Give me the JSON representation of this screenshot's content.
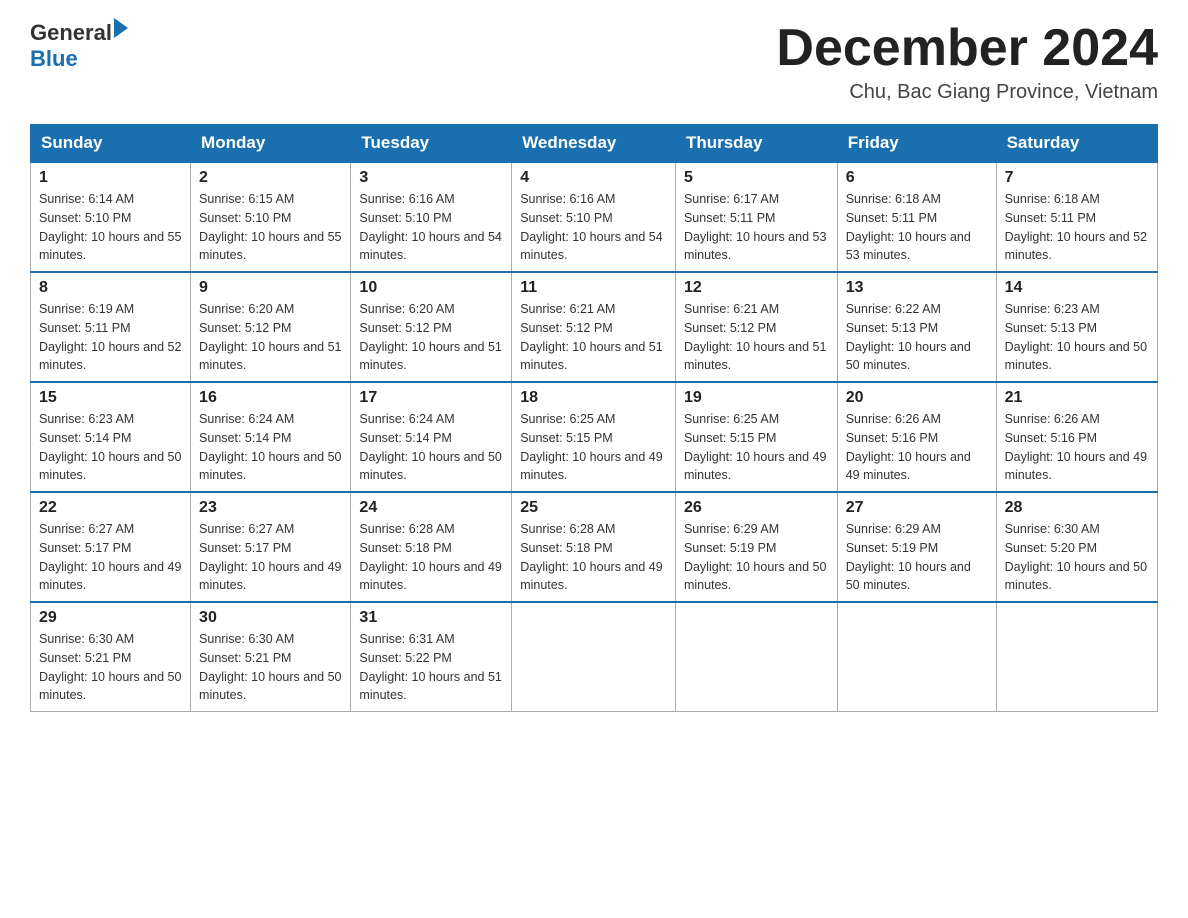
{
  "header": {
    "logo_general": "General",
    "logo_blue": "Blue",
    "title": "December 2024",
    "subtitle": "Chu, Bac Giang Province, Vietnam"
  },
  "weekdays": [
    "Sunday",
    "Monday",
    "Tuesday",
    "Wednesday",
    "Thursday",
    "Friday",
    "Saturday"
  ],
  "weeks": [
    [
      {
        "day": "1",
        "sunrise": "6:14 AM",
        "sunset": "5:10 PM",
        "daylight": "10 hours and 55 minutes."
      },
      {
        "day": "2",
        "sunrise": "6:15 AM",
        "sunset": "5:10 PM",
        "daylight": "10 hours and 55 minutes."
      },
      {
        "day": "3",
        "sunrise": "6:16 AM",
        "sunset": "5:10 PM",
        "daylight": "10 hours and 54 minutes."
      },
      {
        "day": "4",
        "sunrise": "6:16 AM",
        "sunset": "5:10 PM",
        "daylight": "10 hours and 54 minutes."
      },
      {
        "day": "5",
        "sunrise": "6:17 AM",
        "sunset": "5:11 PM",
        "daylight": "10 hours and 53 minutes."
      },
      {
        "day": "6",
        "sunrise": "6:18 AM",
        "sunset": "5:11 PM",
        "daylight": "10 hours and 53 minutes."
      },
      {
        "day": "7",
        "sunrise": "6:18 AM",
        "sunset": "5:11 PM",
        "daylight": "10 hours and 52 minutes."
      }
    ],
    [
      {
        "day": "8",
        "sunrise": "6:19 AM",
        "sunset": "5:11 PM",
        "daylight": "10 hours and 52 minutes."
      },
      {
        "day": "9",
        "sunrise": "6:20 AM",
        "sunset": "5:12 PM",
        "daylight": "10 hours and 51 minutes."
      },
      {
        "day": "10",
        "sunrise": "6:20 AM",
        "sunset": "5:12 PM",
        "daylight": "10 hours and 51 minutes."
      },
      {
        "day": "11",
        "sunrise": "6:21 AM",
        "sunset": "5:12 PM",
        "daylight": "10 hours and 51 minutes."
      },
      {
        "day": "12",
        "sunrise": "6:21 AM",
        "sunset": "5:12 PM",
        "daylight": "10 hours and 51 minutes."
      },
      {
        "day": "13",
        "sunrise": "6:22 AM",
        "sunset": "5:13 PM",
        "daylight": "10 hours and 50 minutes."
      },
      {
        "day": "14",
        "sunrise": "6:23 AM",
        "sunset": "5:13 PM",
        "daylight": "10 hours and 50 minutes."
      }
    ],
    [
      {
        "day": "15",
        "sunrise": "6:23 AM",
        "sunset": "5:14 PM",
        "daylight": "10 hours and 50 minutes."
      },
      {
        "day": "16",
        "sunrise": "6:24 AM",
        "sunset": "5:14 PM",
        "daylight": "10 hours and 50 minutes."
      },
      {
        "day": "17",
        "sunrise": "6:24 AM",
        "sunset": "5:14 PM",
        "daylight": "10 hours and 50 minutes."
      },
      {
        "day": "18",
        "sunrise": "6:25 AM",
        "sunset": "5:15 PM",
        "daylight": "10 hours and 49 minutes."
      },
      {
        "day": "19",
        "sunrise": "6:25 AM",
        "sunset": "5:15 PM",
        "daylight": "10 hours and 49 minutes."
      },
      {
        "day": "20",
        "sunrise": "6:26 AM",
        "sunset": "5:16 PM",
        "daylight": "10 hours and 49 minutes."
      },
      {
        "day": "21",
        "sunrise": "6:26 AM",
        "sunset": "5:16 PM",
        "daylight": "10 hours and 49 minutes."
      }
    ],
    [
      {
        "day": "22",
        "sunrise": "6:27 AM",
        "sunset": "5:17 PM",
        "daylight": "10 hours and 49 minutes."
      },
      {
        "day": "23",
        "sunrise": "6:27 AM",
        "sunset": "5:17 PM",
        "daylight": "10 hours and 49 minutes."
      },
      {
        "day": "24",
        "sunrise": "6:28 AM",
        "sunset": "5:18 PM",
        "daylight": "10 hours and 49 minutes."
      },
      {
        "day": "25",
        "sunrise": "6:28 AM",
        "sunset": "5:18 PM",
        "daylight": "10 hours and 49 minutes."
      },
      {
        "day": "26",
        "sunrise": "6:29 AM",
        "sunset": "5:19 PM",
        "daylight": "10 hours and 50 minutes."
      },
      {
        "day": "27",
        "sunrise": "6:29 AM",
        "sunset": "5:19 PM",
        "daylight": "10 hours and 50 minutes."
      },
      {
        "day": "28",
        "sunrise": "6:30 AM",
        "sunset": "5:20 PM",
        "daylight": "10 hours and 50 minutes."
      }
    ],
    [
      {
        "day": "29",
        "sunrise": "6:30 AM",
        "sunset": "5:21 PM",
        "daylight": "10 hours and 50 minutes."
      },
      {
        "day": "30",
        "sunrise": "6:30 AM",
        "sunset": "5:21 PM",
        "daylight": "10 hours and 50 minutes."
      },
      {
        "day": "31",
        "sunrise": "6:31 AM",
        "sunset": "5:22 PM",
        "daylight": "10 hours and 51 minutes."
      },
      null,
      null,
      null,
      null
    ]
  ]
}
